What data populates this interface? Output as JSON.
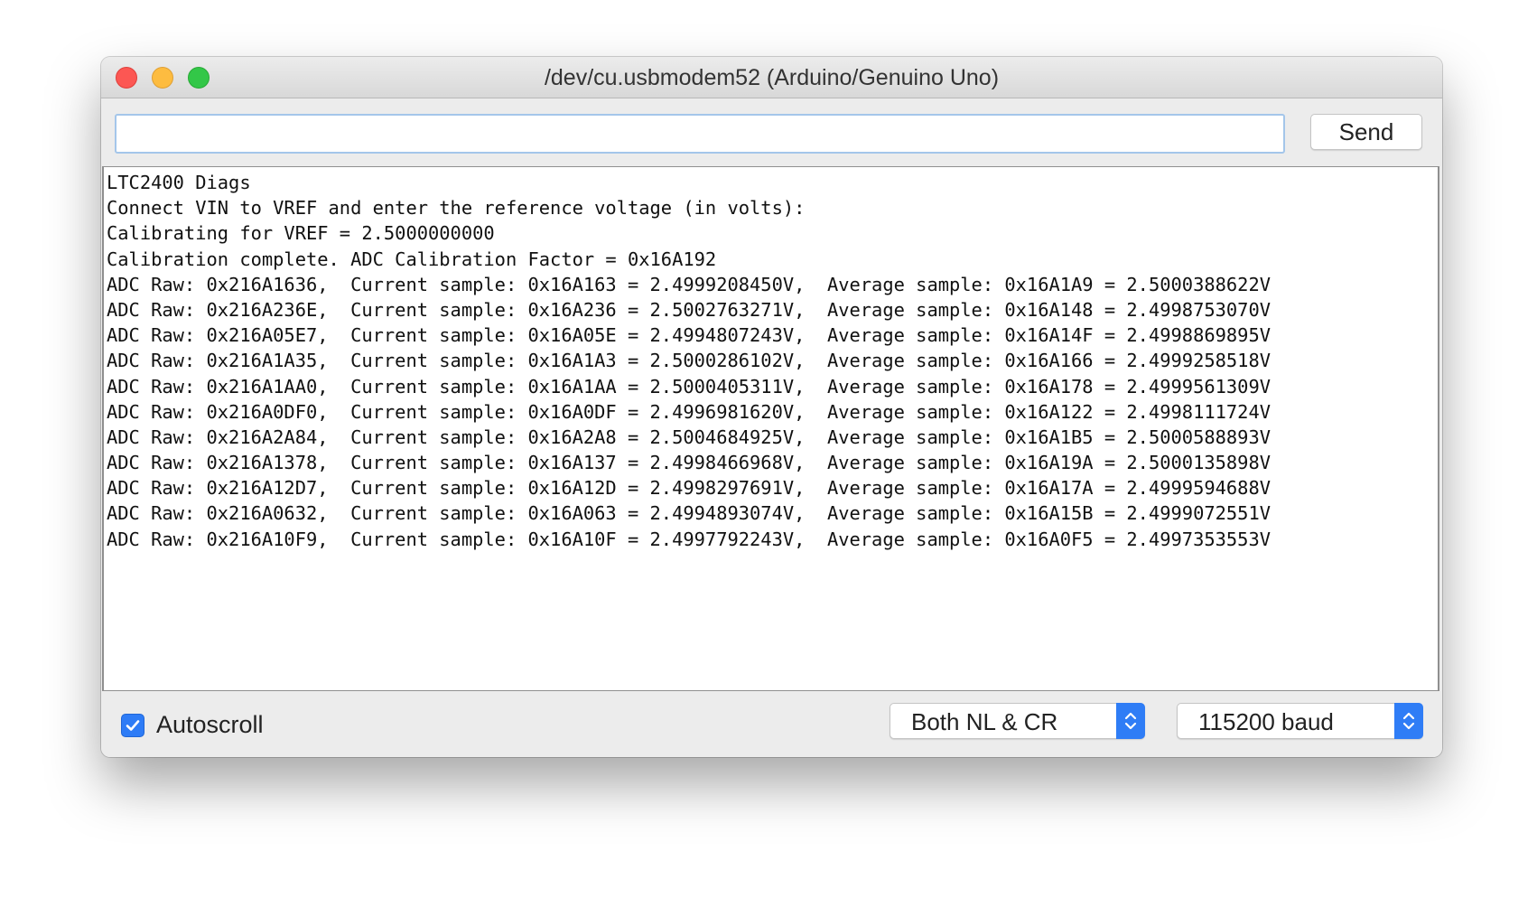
{
  "window": {
    "title": "/dev/cu.usbmodem52 (Arduino/Genuino Uno)"
  },
  "input": {
    "value": "",
    "placeholder": ""
  },
  "toolbar": {
    "send_label": "Send"
  },
  "output": {
    "lines": [
      "LTC2400 Diags",
      "Connect VIN to VREF and enter the reference voltage (in volts):",
      "Calibrating for VREF = 2.5000000000",
      "Calibration complete. ADC Calibration Factor = 0x16A192",
      "ADC Raw: 0x216A1636,  Current sample: 0x16A163 = 2.4999208450V,  Average sample: 0x16A1A9 = 2.5000388622V",
      "ADC Raw: 0x216A236E,  Current sample: 0x16A236 = 2.5002763271V,  Average sample: 0x16A148 = 2.4998753070V",
      "ADC Raw: 0x216A05E7,  Current sample: 0x16A05E = 2.4994807243V,  Average sample: 0x16A14F = 2.4998869895V",
      "ADC Raw: 0x216A1A35,  Current sample: 0x16A1A3 = 2.5000286102V,  Average sample: 0x16A166 = 2.4999258518V",
      "ADC Raw: 0x216A1AA0,  Current sample: 0x16A1AA = 2.5000405311V,  Average sample: 0x16A178 = 2.4999561309V",
      "ADC Raw: 0x216A0DF0,  Current sample: 0x16A0DF = 2.4996981620V,  Average sample: 0x16A122 = 2.4998111724V",
      "ADC Raw: 0x216A2A84,  Current sample: 0x16A2A8 = 2.5004684925V,  Average sample: 0x16A1B5 = 2.5000588893V",
      "ADC Raw: 0x216A1378,  Current sample: 0x16A137 = 2.4998466968V,  Average sample: 0x16A19A = 2.5000135898V",
      "ADC Raw: 0x216A12D7,  Current sample: 0x16A12D = 2.4998297691V,  Average sample: 0x16A17A = 2.4999594688V",
      "ADC Raw: 0x216A0632,  Current sample: 0x16A063 = 2.4994893074V,  Average sample: 0x16A15B = 2.4999072551V",
      "ADC Raw: 0x216A10F9,  Current sample: 0x16A10F = 2.4997792243V,  Average sample: 0x16A0F5 = 2.4997353553V"
    ]
  },
  "footer": {
    "autoscroll_label": "Autoscroll",
    "autoscroll_checked": true,
    "line_ending_selected": "Both NL & CR",
    "baud_selected": "115200 baud"
  },
  "colors": {
    "accent": "#2f7df6",
    "close": "#fc5753",
    "minimize": "#fdbc40",
    "zoom": "#33c748"
  },
  "icons": {
    "close": "close-icon",
    "minimize": "minimize-icon",
    "zoom": "zoom-icon",
    "checkmark": "checkmark-icon",
    "select_arrows": "chevron-up-down-icon"
  }
}
